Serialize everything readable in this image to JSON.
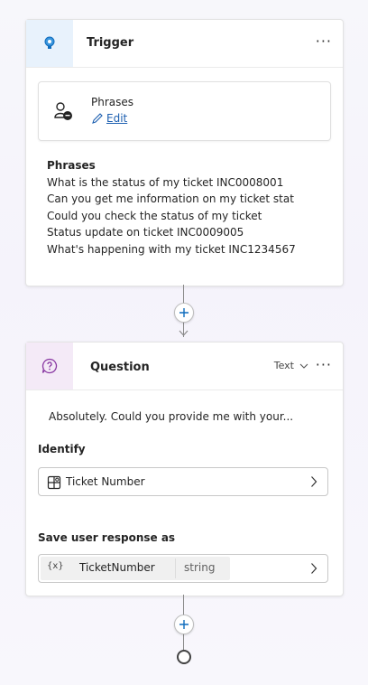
{
  "trigger": {
    "title": "Trigger",
    "more": "···",
    "phrases_card": {
      "title": "Phrases",
      "edit_label": "Edit"
    },
    "phrases_heading": "Phrases",
    "phrases": [
      "What is the status of my ticket INC0008001",
      "Can you get me information on my ticket stat",
      "Could you check the status of my ticket",
      "Status update on ticket INC0009005",
      "What's happening with my ticket INC1234567"
    ]
  },
  "question": {
    "title": "Question",
    "response_type": "Text",
    "more": "···",
    "message": "Absolutely. Could you provide me with your...",
    "identify_label": "Identify",
    "identify_value": "Ticket Number",
    "save_label": "Save user response as",
    "variable_badge": "{x}",
    "variable_name": "TicketNumber",
    "variable_type": "string"
  },
  "colors": {
    "trigger_accent": "#0f6cbd",
    "question_accent": "#8a3aa3",
    "link": "#1c5fb0"
  }
}
